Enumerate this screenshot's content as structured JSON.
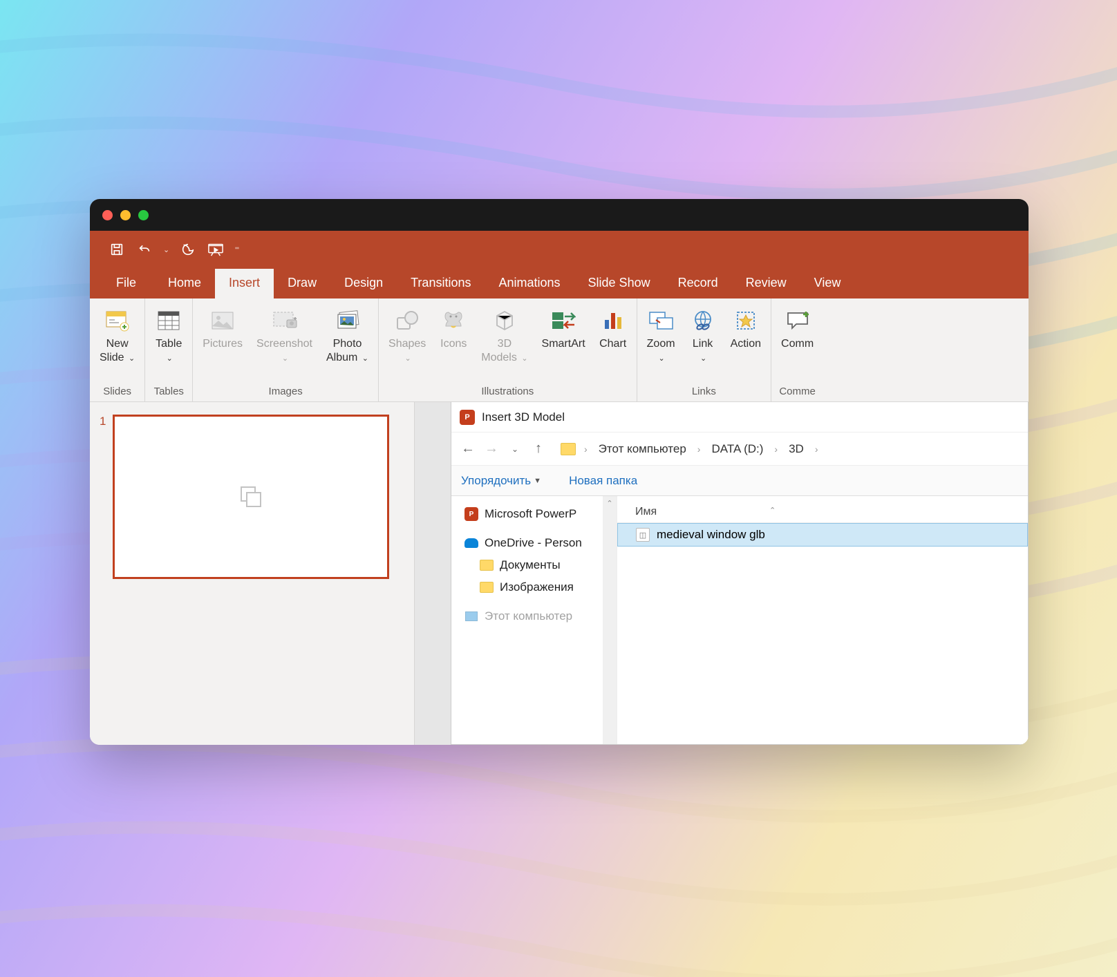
{
  "tabs": {
    "file": "File",
    "home": "Home",
    "insert": "Insert",
    "draw": "Draw",
    "design": "Design",
    "transitions": "Transitions",
    "animations": "Animations",
    "slideshow": "Slide Show",
    "record": "Record",
    "review": "Review",
    "view": "View"
  },
  "ribbon": {
    "groups": {
      "slides": "Slides",
      "tables": "Tables",
      "images": "Images",
      "illustrations": "Illustrations",
      "links": "Links",
      "comments": "Comme"
    },
    "buttons": {
      "new_slide": "New\nSlide",
      "table": "Table",
      "pictures": "Pictures",
      "screenshot": "Screenshot",
      "photo_album": "Photo\nAlbum",
      "shapes": "Shapes",
      "icons": "Icons",
      "models3d": "3D\nModels",
      "smartart": "SmartArt",
      "chart": "Chart",
      "zoom": "Zoom",
      "link": "Link",
      "action": "Action",
      "comment": "Comm"
    }
  },
  "slide": {
    "number": "1"
  },
  "dialog": {
    "title": "Insert 3D Model",
    "breadcrumb": [
      "Этот компьютер",
      "DATA (D:)",
      "3D"
    ],
    "toolbar": {
      "organize": "Упорядочить",
      "new_folder": "Новая папка"
    },
    "tree": {
      "powerpoint": "Microsoft PowerP",
      "onedrive": "OneDrive - Person",
      "documents": "Документы",
      "images": "Изображения",
      "computer": "Этот компьютер"
    },
    "list": {
      "column_name": "Имя",
      "file": "medieval window glb"
    }
  }
}
